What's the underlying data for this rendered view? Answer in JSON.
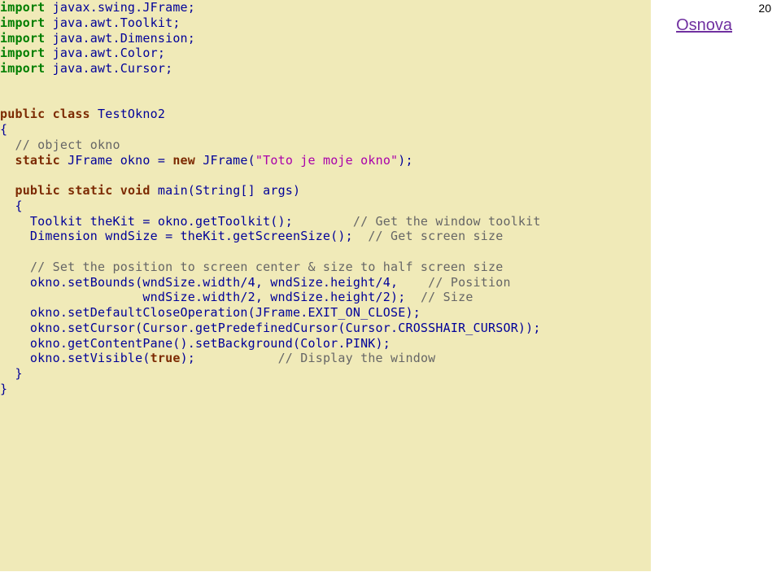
{
  "pageNumber": "20",
  "osnovaLabel": "Osnova",
  "lines": {
    "l1a": "import",
    "l1b": " javax.swing.JFrame;",
    "l2a": "import",
    "l2b": " java.awt.Toolkit;",
    "l3a": "import",
    "l3b": " java.awt.Dimension;",
    "l4a": "import",
    "l4b": " java.awt.Color;",
    "l5a": "import",
    "l5b": " java.awt.Cursor;",
    "l6": "public",
    "l6b": " ",
    "l6c": "class",
    "l6d": " TestOkno2",
    "l7": "{",
    "l8a": "  ",
    "l8b": "// object okno",
    "l9a": "  ",
    "l9b": "static",
    "l9c": " JFrame okno = ",
    "l9d": "new",
    "l9e": " JFrame(",
    "l9f": "\"Toto je moje okno\"",
    "l9g": ");",
    "l10a": "  ",
    "l10b": "public",
    "l10c": " ",
    "l10d": "static",
    "l10e": " ",
    "l10f": "void",
    "l10g": " main(String[] args)",
    "l11": "  {",
    "l12a": "    Toolkit theKit = okno.getToolkit();        ",
    "l12b": "// Get the window toolkit",
    "l13a": "    Dimension wndSize = theKit.getScreenSize();  ",
    "l13b": "// Get screen size",
    "l14a": "    ",
    "l14b": "// Set the position to screen center & size to half screen size",
    "l15a": "    okno.setBounds(wndSize.width/4, wndSize.height/4,    ",
    "l15b": "// Position",
    "l16a": "                   wndSize.width/2, wndSize.height/2);  ",
    "l16b": "// Size",
    "l17": "    okno.setDefaultCloseOperation(JFrame.EXIT_ON_CLOSE);",
    "l18": "    okno.setCursor(Cursor.getPredefinedCursor(Cursor.CROSSHAIR_CURSOR));",
    "l19": "    okno.getContentPane().setBackground(Color.PINK);",
    "l20a": "    okno.setVisible(",
    "l20b": "true",
    "l20c": ");           ",
    "l20d": "// Display the window",
    "l21": "  }",
    "l22": "}"
  }
}
